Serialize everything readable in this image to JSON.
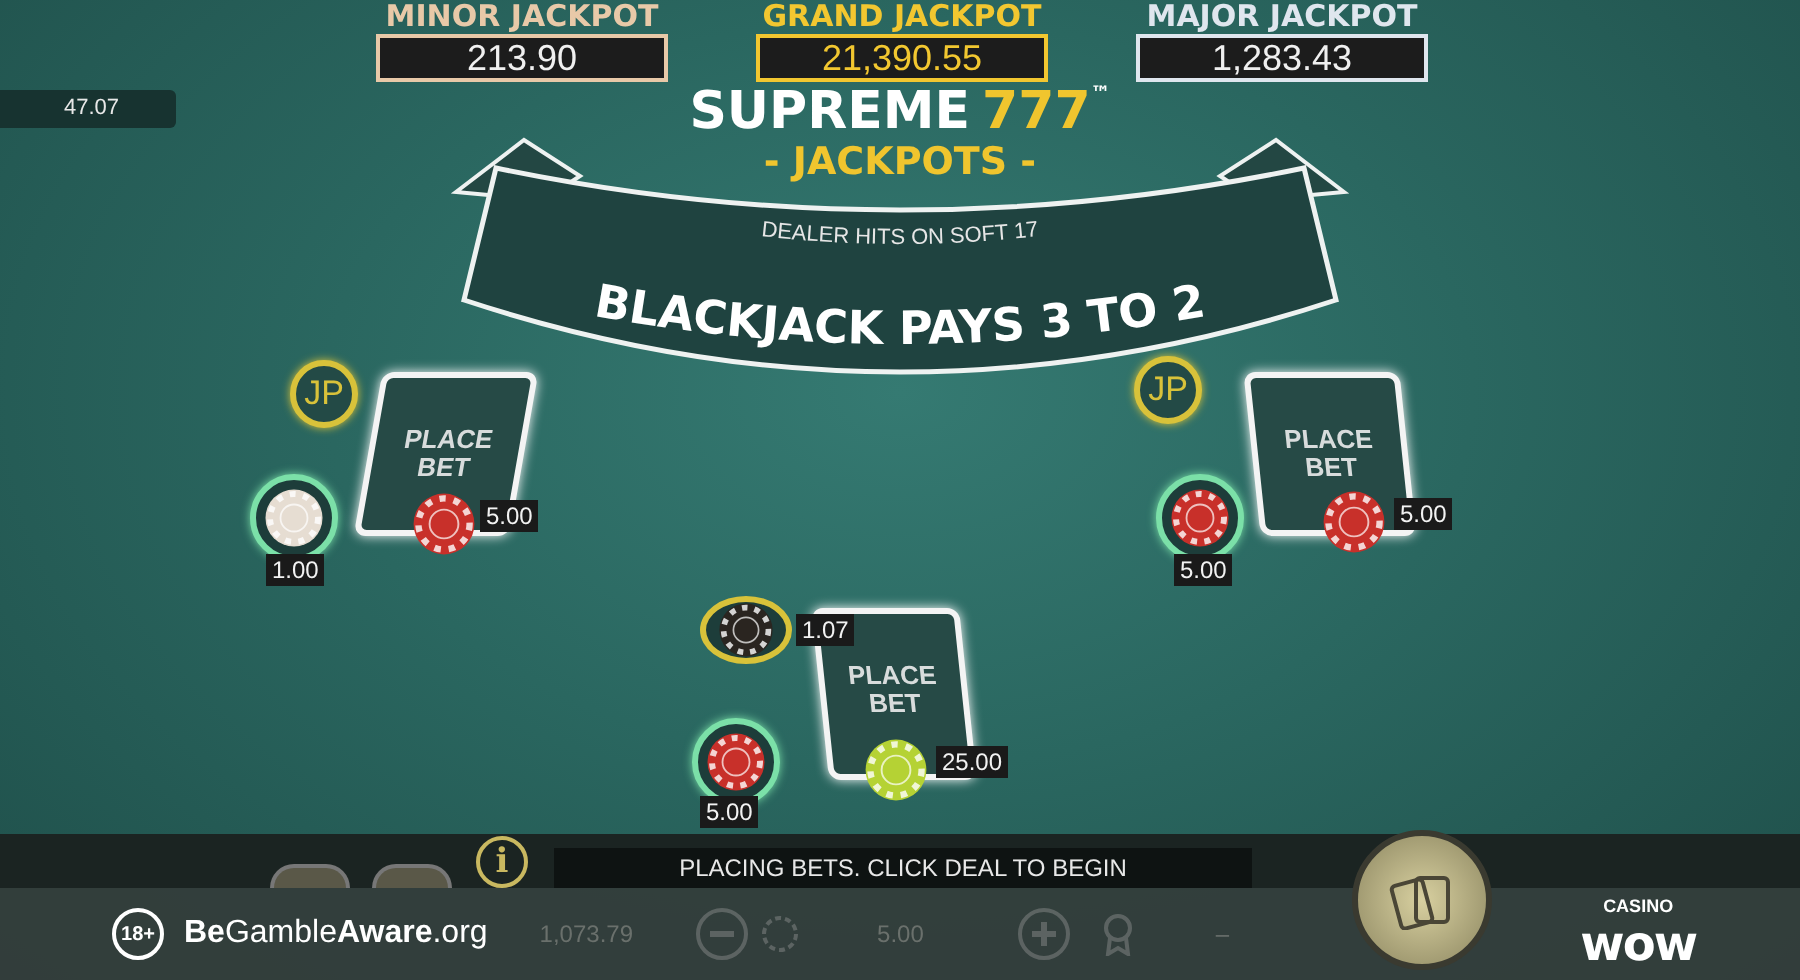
{
  "jackpots": [
    {
      "kind": "minor",
      "label": "MINOR JACKPOT",
      "value": "213.90"
    },
    {
      "kind": "grand",
      "label": "GRAND JACKPOT",
      "value": "21,390.55"
    },
    {
      "kind": "major",
      "label": "MAJOR JACKPOT",
      "value": "1,283.43"
    }
  ],
  "balance_tag": "47.07",
  "logo": {
    "title": "SUPREME",
    "number": "777",
    "trademark": "™",
    "subtitle": "- JACKPOTS -"
  },
  "banner": {
    "rule": "DEALER HITS ON SOFT 17",
    "payout": "BLACKJACK PAYS 3 TO 2"
  },
  "spots": [
    {
      "place_label": "PLACE BET",
      "main_chip": {
        "color": "#c8302a",
        "amount": "5.00"
      },
      "side_chip": {
        "color": "#e6ddd2",
        "amount": "1.00"
      },
      "jackpot": {
        "kind": "label",
        "text": "JP"
      }
    },
    {
      "place_label": "PLACE BET",
      "main_chip": {
        "color": "#b5d234",
        "amount": "25.00"
      },
      "side_chip": {
        "color": "#c8302a",
        "amount": "5.00"
      },
      "jackpot": {
        "kind": "chip",
        "color": "#2a2520",
        "amount": "1.07"
      }
    },
    {
      "place_label": "PLACE BET",
      "main_chip": {
        "color": "#c8302a",
        "amount": "5.00"
      },
      "side_chip": {
        "color": "#c8302a",
        "amount": "5.00"
      },
      "jackpot": {
        "kind": "label",
        "text": "JP"
      }
    }
  ],
  "info_label": "i",
  "status_message": "PLACING BETS. CLICK DEAL TO BEGIN",
  "footer": {
    "age_badge": "18+",
    "gamble_aware": "**Be**Gamble**Aware**.org",
    "balance": "1,073.79",
    "bet": "5.00",
    "win": "–",
    "brand_top": "CASINO",
    "brand_main": "wow"
  }
}
